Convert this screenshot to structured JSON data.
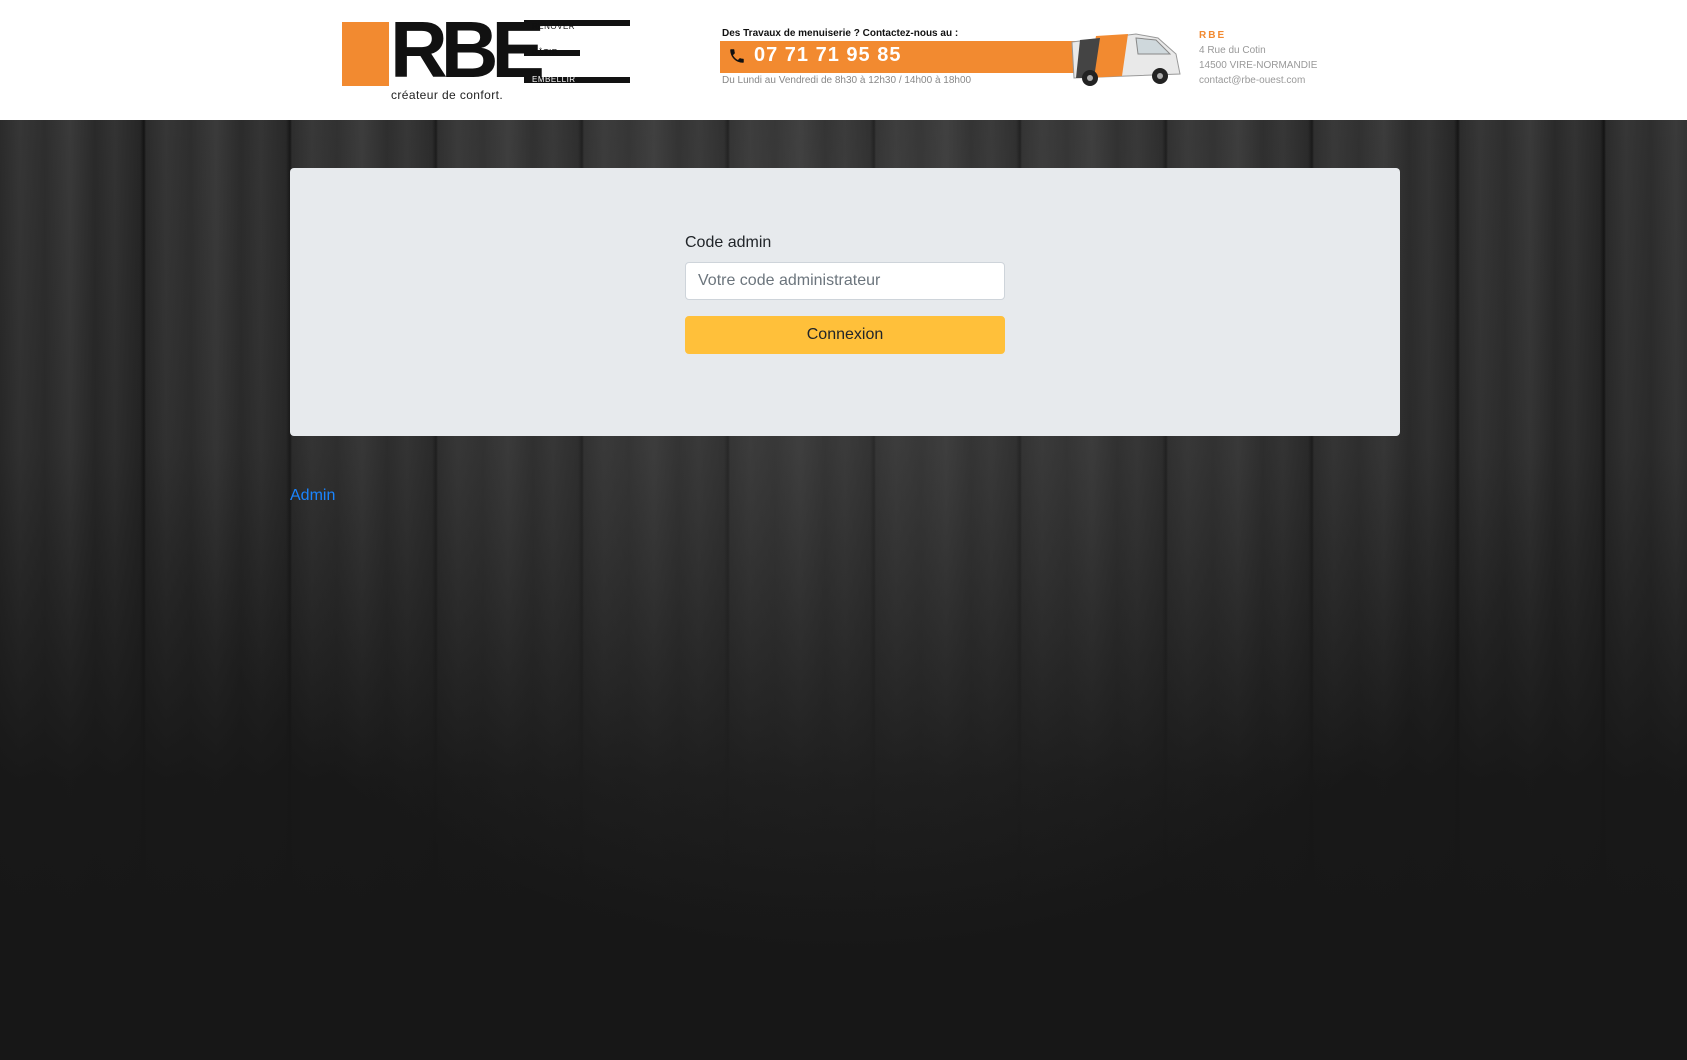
{
  "header": {
    "logo": {
      "letters": "RBE",
      "words": [
        "RÉNOVER",
        "BÂTIR",
        "EMBELLIR"
      ],
      "tagline": "créateur de confort."
    },
    "contact": {
      "title": "Des Travaux de menuiserie ? Contactez-nous au :",
      "phone": "07 71 71 95 85",
      "hours": "Du Lundi au Vendredi de 8h30 à 12h30 / 14h00 à 18h00"
    },
    "company": {
      "name": "RBE",
      "address1": "4 Rue du Cotin",
      "address2": "14500 VIRE-NORMANDIE",
      "email": "contact@rbe-ouest.com"
    }
  },
  "form": {
    "label": "Code admin",
    "placeholder": "Votre code administrateur",
    "value": "",
    "button": "Connexion"
  },
  "footer": {
    "admin_link": "Admin"
  },
  "colors": {
    "brand_orange": "#f28a30",
    "button_yellow": "#ffc03a",
    "link_blue": "#1a85ff",
    "card_bg": "#e7eaed"
  }
}
